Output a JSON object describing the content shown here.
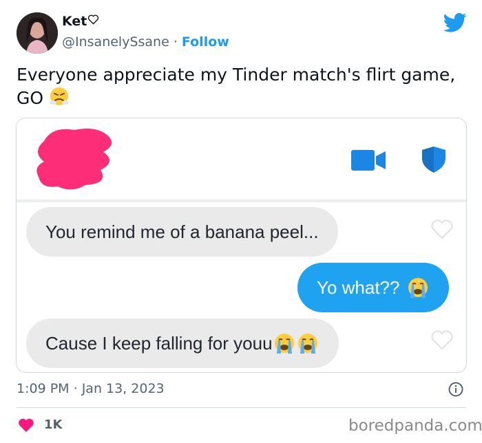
{
  "author": {
    "name": "Ket",
    "name_icon": "heart-outline-icon",
    "handle": "@InsanelySsane",
    "separator": "·",
    "follow_label": "Follow"
  },
  "platform_icon": "twitter-bird-icon",
  "tweet": {
    "text": "Everyone appreciate my Tinder match's flirt game, GO",
    "text_emoji": "steam-from-nose-emoji"
  },
  "chat": {
    "header_icons": [
      "video-call-icon",
      "shield-icon"
    ],
    "messages": [
      {
        "direction": "received",
        "text": "You remind me of a banana peel..."
      },
      {
        "direction": "sent",
        "text": "Yo what??",
        "emoji": [
          "loudly-crying-emoji"
        ]
      },
      {
        "direction": "received",
        "text": "Cause I keep falling for youu",
        "emoji": [
          "loudly-crying-emoji",
          "loudly-crying-emoji"
        ]
      }
    ]
  },
  "meta": {
    "time": "1:09 PM",
    "separator": "·",
    "date": "Jan 13, 2023"
  },
  "engagement": {
    "likes": "1K"
  },
  "watermark": "boredpanda.com",
  "colors": {
    "twitter_blue": "#1d9bf0",
    "like_pink": "#f91880",
    "sent_bubble": "#1fa3f0",
    "received_bubble": "#eaeaea",
    "scribble": "#fe2d78",
    "tinder_blue": "#1c86e4"
  }
}
